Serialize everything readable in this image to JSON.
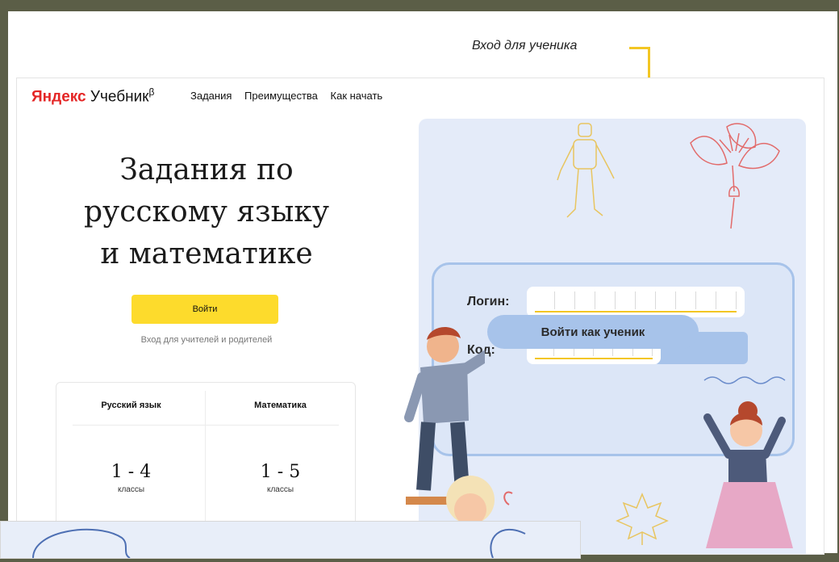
{
  "annotation": {
    "callout": "Вход для ученика"
  },
  "header": {
    "logo_brand": "Яндекс",
    "logo_product": "Учебник",
    "logo_sup": "β",
    "nav": [
      "Задания",
      "Преимущества",
      "Как начать"
    ]
  },
  "hero": {
    "title_lines": [
      "Задания по",
      "русскому языку",
      "и математике"
    ],
    "login_button": "Войти",
    "teacher_link": "Вход для учителей и родителей"
  },
  "grades": [
    {
      "subject": "Русский язык",
      "range": "1 - 4",
      "unit": "классы"
    },
    {
      "subject": "Математика",
      "range": "1 - 5",
      "unit": "классы"
    }
  ],
  "student_form": {
    "login_label": "Логин:",
    "code_label": "Код:",
    "login_value": "",
    "code_value": "",
    "submit_label": "Войти как ученик"
  },
  "colors": {
    "accent": "#fddb2c",
    "panel": "#e4ebf9",
    "form_border": "#a7c3ea",
    "brand_red": "#e42525",
    "callout_line": "#f3c623"
  }
}
